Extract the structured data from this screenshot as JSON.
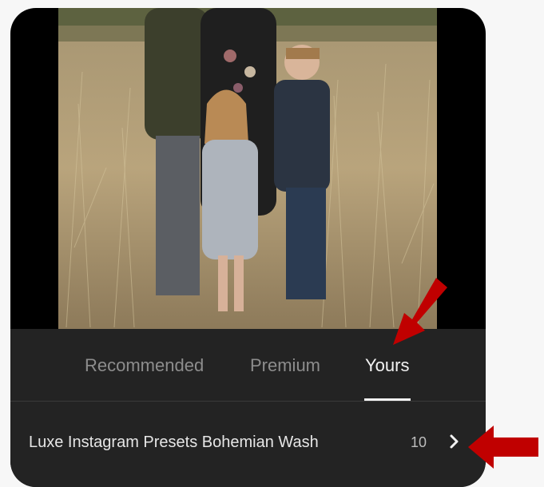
{
  "tabs": [
    {
      "label": "Recommended",
      "active": false
    },
    {
      "label": "Premium",
      "active": false
    },
    {
      "label": "Yours",
      "active": true
    }
  ],
  "preset_group": {
    "name": "Luxe Instagram Presets Bohemian Wash",
    "count": "10",
    "icon": "chevron-right-icon"
  },
  "annotations": {
    "arrow_color": "#c00000"
  },
  "colors": {
    "panel_bg": "#232323",
    "tab_inactive": "#8d8d8d",
    "tab_active": "#f2f2f2"
  }
}
